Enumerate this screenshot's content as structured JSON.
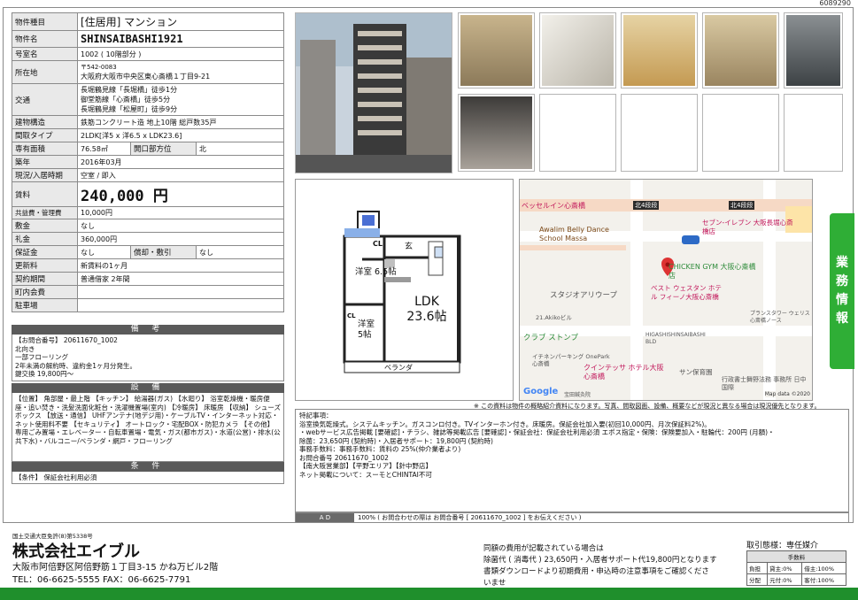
{
  "listing_id": "6089290",
  "property": {
    "rows": [
      {
        "key": "物件種目",
        "value": "[住居用] マンション"
      },
      {
        "key": "物件名",
        "value": "SHINSAIBASHI1921"
      },
      {
        "key": "号室名",
        "value": "1002 ( 10階部分 )"
      },
      {
        "key": "所在地",
        "postal": "〒542-0083",
        "value": "大阪府大阪市中央区東心斎橋１丁目9-21"
      },
      {
        "key": "交通",
        "lines": [
          "長堀鶴見線「長堀橋」徒歩1分",
          "御堂筋線「心斎橋」徒歩5分",
          "長堀鶴見線「松屋町」徒歩9分"
        ]
      },
      {
        "key": "建物構造",
        "value": "鉄筋コンクリート造  地上10階  総戸数35戸"
      },
      {
        "key": "間取タイプ",
        "value": "2LDK[洋5 x 洋6.5 x LDK23.6]"
      },
      {
        "key": "専有面積",
        "value": "76.58㎡",
        "key2": "開口部方位",
        "value2": "北"
      },
      {
        "key": "築年",
        "value": "2016年03月"
      },
      {
        "key": "現況/入居時期",
        "value": "空室 / 即入"
      },
      {
        "key": "賃料",
        "value": "240,000 円"
      },
      {
        "key": "共益費・管理費",
        "value": "10,000円"
      },
      {
        "key": "敷金",
        "value": "なし"
      },
      {
        "key": "礼金",
        "value": "360,000円"
      },
      {
        "key": "保証金",
        "value": "なし",
        "key2": "償却・敷引",
        "value2": "なし"
      },
      {
        "key": "更新料",
        "value": "新賃料の1ヶ月"
      },
      {
        "key": "契約期間",
        "value": "普通借家 2年間"
      },
      {
        "key": "町内会費",
        "value": ""
      },
      {
        "key": "駐車場",
        "value": ""
      }
    ]
  },
  "bikou": {
    "title": "備  考",
    "lines": [
      "【お問合番号】 20611670_1002",
      "北向き",
      "一部フローリング",
      "2年未満の解約時、違約金1ヶ月分発生。",
      "鍵交換 19,800円～"
    ]
  },
  "setsubi": {
    "title": "設  備",
    "text": "【位置】 角部屋・最上階 【キッチン】 給湯器(ガス) 【水廻り】 浴室乾燥機・暖房便座・追い焚き・洗髪洗面化粧台・洗濯機置場(室内) 【冷暖房】 床暖房 【収納】 シューズボックス 【放送・通信】 UHFアンテナ(地デジ用)・ケーブルTV・インターネット対応・ネット使用料不要 【セキュリティ】 オートロック・宅配BOX・防犯カメラ 【その他】 専用ごみ置場・エレベーター・自転車置場・電気・ガス(都市ガス)・水道(公営)・排水(公共下水)・バルコニー/ベランダ・網戸・フローリング"
  },
  "jouken": {
    "title": "条  件",
    "text": "【条件】 保証会社利用必須"
  },
  "floorplan": {
    "rooms": [
      "洋室 6.5帖",
      "LDK 23.6帖",
      "洋室 5帖"
    ],
    "labels": [
      "CL",
      "CL",
      "玄",
      "ベランダ"
    ]
  },
  "map": {
    "labels": [
      "ベッセルイン心斎橋",
      "北4段段",
      "北4段段",
      "Awalim Belly Dance School Massa",
      "セブン-イレブン 大阪長堀心斎橋店",
      "CHICKEN GYM 大阪心斎橋店",
      "スタジオアリウープ",
      "ベスト ウェスタン ホテル フィーノ大阪心斎橋",
      "クラブ ストンプ",
      "HIGASHISHINSAIBASHI BLD",
      "イチネンパーキング OnePark心斎橋",
      "クインテッサ ホテル大阪心斎橋",
      "サン保育園",
      "行政書士舞野法務 事務所 日中国際",
      "プランスタワー ウェリス心斎橋ノース",
      "21.Akikoビル",
      "宝田鍼灸院"
    ],
    "google": "Google",
    "copyright": "Map data ©2020"
  },
  "disclaimer": "※ この資料は物件の概略紹介資料になります。写真、間取図面、設備、概要などが現況と異なる場合は現況優先となります。",
  "remarks": {
    "lines": [
      "特記事項：",
      "浴室換気乾燥式。システムキッチン。ガスコンロ付き。TVインターホン付き。床暖房。保証会社加入要(初回10,000円、月次保証料2%)。",
      "・webサービス広告掲載 [要確認]・チラシ、雑誌等掲載広告 [要確認]・保証会社：保証会社利用必須 エポス指定・保険：保険要加入・駐輪代：200円 (月額)・",
      "除菌：23,650円 (契約時)・入居者サポート：19,800円 (契約時)",
      "事務手数料：事務手数料：賃料の 25%(仲介業者より)",
      "お問合番号 20611670_1002",
      "【南大阪営業部】【平野エリア】【針中野店】",
      "ネット掲載について：スーモとCHINTAI不可"
    ]
  },
  "ad": {
    "label": "A D",
    "text": "100% ( お問合わせの際は お問合番号 [ 20611670_1002 ] をお伝えください )"
  },
  "side_tab": [
    "業",
    "務",
    "情",
    "報"
  ],
  "company": {
    "license": "国土交通大臣免許(8)第5338号",
    "name": "株式会社エイブル",
    "address": "大阪市阿倍野区阿倍野筋１丁目3-15 かね万ビル2階",
    "contact": "TEL：06-6625-5555   FAX：06-6625-7791"
  },
  "fee_note": [
    "同額の費用が記載されている場合は",
    "除菌代 ( 消毒代 ) 23,650円・入居者サポート代19,800円となります",
    "書類ダウンロードより初期費用・申込時の注意事項をご確認くださ",
    "いませ"
  ],
  "torihiki": {
    "title": "取引態様：専任媒介",
    "header": "手数料",
    "rows": [
      {
        "k": "負担",
        "a": "貸主:0%",
        "b": "借主:100%"
      },
      {
        "k": "分配",
        "a": "元付:0%",
        "b": "客付:100%"
      }
    ]
  },
  "colors": {
    "green": "#2fae36",
    "bar": "#5a5a5a",
    "key_bg": "#e9e9e9",
    "pin": "#d33"
  }
}
